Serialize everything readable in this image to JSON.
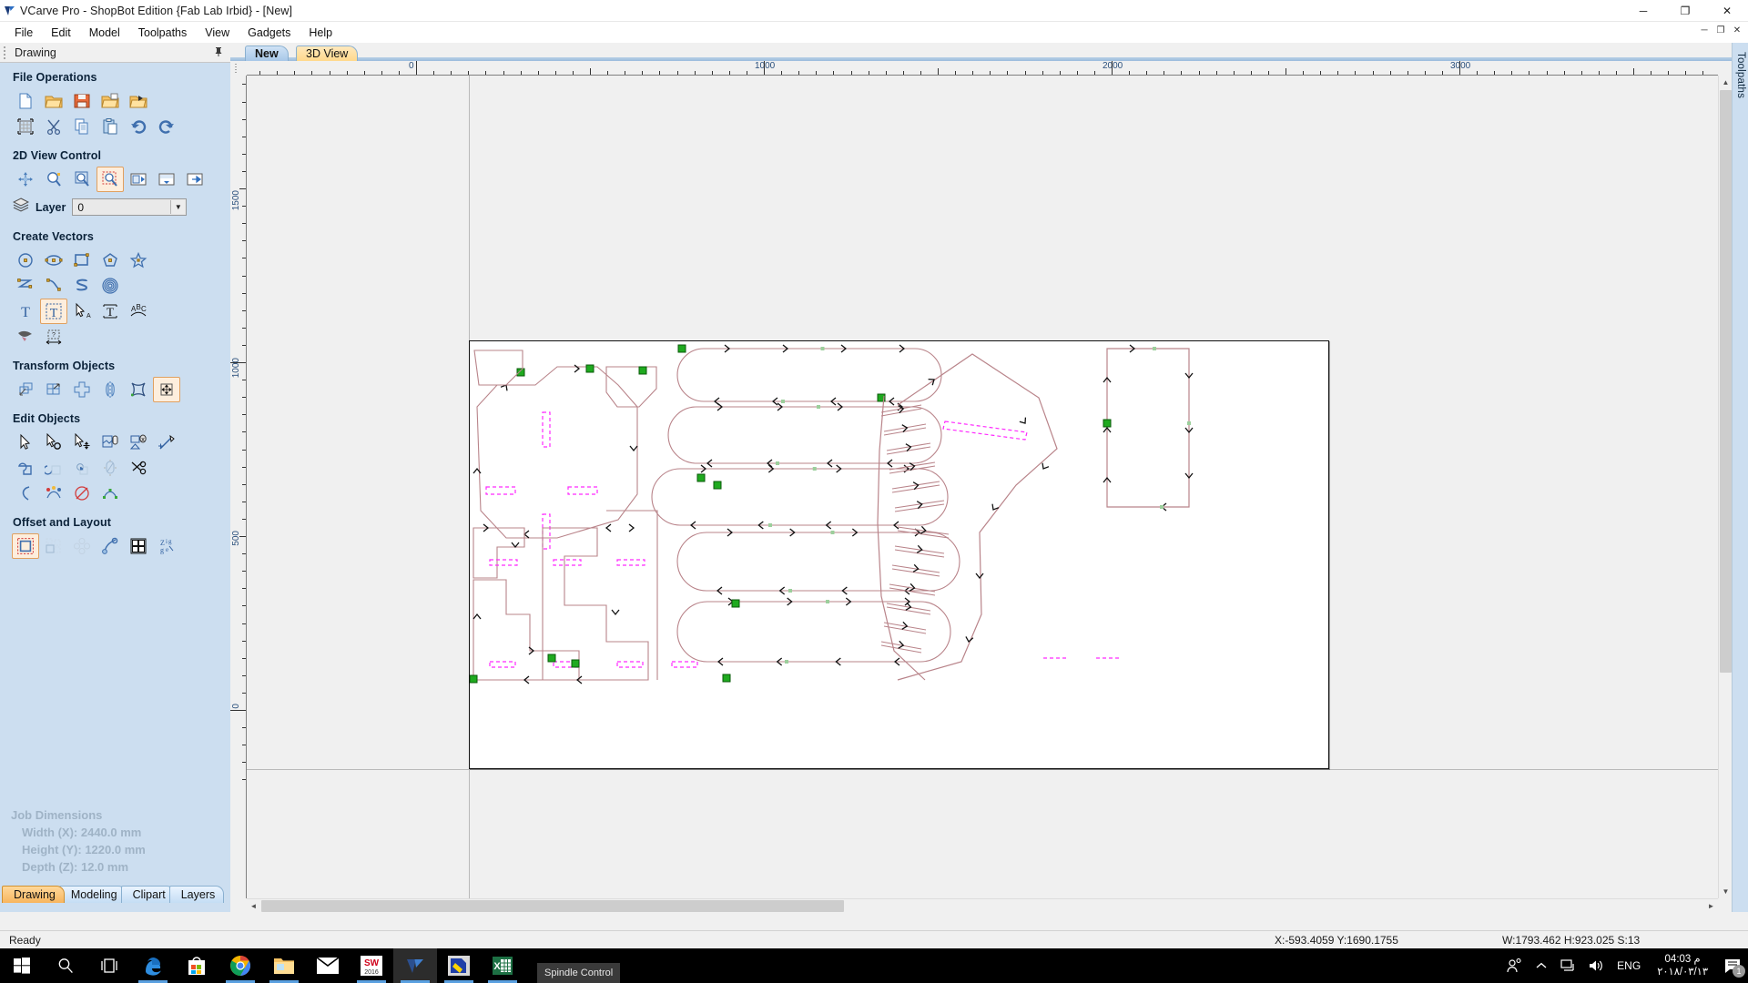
{
  "window": {
    "title": "VCarve Pro - ShopBot Edition {Fab Lab Irbid} - [New]",
    "app_icon": "vcarve-logo-icon",
    "minimize": "─",
    "maximize": "❐",
    "close": "✕",
    "mdi_minimize": "─",
    "mdi_restore": "❐",
    "mdi_close": "✕"
  },
  "menubar": {
    "items": [
      {
        "label": "File"
      },
      {
        "label": "Edit"
      },
      {
        "label": "Model"
      },
      {
        "label": "Toolpaths"
      },
      {
        "label": "View"
      },
      {
        "label": "Gadgets"
      },
      {
        "label": "Help"
      }
    ]
  },
  "left_panel": {
    "caption": "Drawing",
    "pin_icon": "pin-icon",
    "sections": [
      {
        "title": "File Operations",
        "rows": [
          [
            "new-file-icon",
            "open-file-icon",
            "save-file-icon",
            "save-as-icon",
            "import-vectors-icon"
          ],
          [
            "job-setup-icon",
            "cut-icon",
            "copy-icon",
            "paste-icon",
            "undo-icon",
            "redo-icon"
          ]
        ]
      },
      {
        "title": "2D View Control",
        "rows": [
          [
            "pan-view-icon",
            "zoom-interactive-icon",
            "zoom-extents-icon",
            "zoom-box-icon",
            "zoom-selected-icon",
            "zoom-page-icon",
            "toggle-2d3d-icon"
          ]
        ]
      },
      {
        "title": "Create Vectors",
        "rows": [
          [
            "draw-circle-icon",
            "draw-ellipse-icon",
            "draw-rectangle-icon",
            "draw-polygon-icon",
            "draw-star-icon"
          ],
          [
            "draw-polyline-icon",
            "draw-curve-icon",
            "draw-serpentine-icon",
            "draw-spiral-icon"
          ],
          [
            "create-text-icon",
            "edit-text-icon",
            "text-select-icon",
            "text-on-curve-icon",
            "text-on-arc-icon"
          ],
          [
            "trace-bitmap-icon",
            "dimension-icon"
          ]
        ]
      },
      {
        "title": "Transform Objects",
        "rows": [
          [
            "move-objects-icon",
            "scale-objects-icon",
            "rotate-objects-icon",
            "mirror-objects-icon",
            "distort-objects-icon",
            "align-objects-icon"
          ]
        ]
      },
      {
        "title": "Edit Objects",
        "rows": [
          [
            "node-edit-icon",
            "node-tools-icon",
            "move-nodes-icon",
            "join-vectors-icon",
            "close-vector-icon",
            "measure-icon"
          ],
          [
            "weld-vectors-icon",
            "subtract-vectors-icon",
            "intersect-vectors-icon",
            "fillet-icon",
            "trim-vectors-icon"
          ],
          [
            "curve-fit-icon",
            "nest-icon",
            "offset-icon",
            "fit-curve-icon"
          ]
        ]
      },
      {
        "title": "Offset and Layout",
        "rows": [
          [
            "offset-vectors-icon",
            "array-copy-icon",
            "circular-copy-icon",
            "copy-along-curve-icon",
            "block-copy-icon",
            "nest-parts-icon"
          ]
        ]
      }
    ],
    "layer": {
      "label": "Layer",
      "icon": "layers-icon",
      "value": "0",
      "dropdown_icon": "chevron-down-icon"
    },
    "job_dimensions": {
      "title": "Job Dimensions",
      "lines": [
        "Width  (X): 2440.0 mm",
        "Height (Y): 1220.0 mm",
        "Depth  (Z): 12.0 mm"
      ]
    },
    "bottom_tabs": [
      {
        "label": "Drawing",
        "active": true
      },
      {
        "label": "Modeling",
        "active": false
      },
      {
        "label": "Clipart",
        "active": false
      },
      {
        "label": "Layers",
        "active": false
      }
    ]
  },
  "main": {
    "view_tabs": [
      {
        "label": "New",
        "active": true
      },
      {
        "label": "3D View",
        "active": false
      }
    ],
    "h_ruler": {
      "labels": [
        "0",
        "1000",
        "2000",
        "3000"
      ],
      "unit": "mm"
    },
    "v_ruler": {
      "labels": [
        "1500",
        "1000",
        "500",
        "0"
      ],
      "unit": "mm"
    },
    "scrollbars": {
      "up_arrow": "▲",
      "down_arrow": "▼",
      "left_arrow": "◄",
      "right_arrow": "►"
    }
  },
  "right_dock": {
    "label": "Toolpaths"
  },
  "statusbar": {
    "ready": "Ready",
    "coords": "X:-593.4059 Y:1690.1755",
    "selection": "W:1793.462   H:923.025  S:13"
  },
  "taskbar": {
    "items": [
      {
        "name": "start-button",
        "icon": "windows-logo-icon"
      },
      {
        "name": "search-button",
        "icon": "search-icon"
      },
      {
        "name": "task-view-button",
        "icon": "task-view-icon"
      },
      {
        "name": "edge-button",
        "icon": "edge-icon",
        "running": true
      },
      {
        "name": "store-button",
        "icon": "microsoft-store-icon",
        "running": false
      },
      {
        "name": "chrome-button",
        "icon": "chrome-icon",
        "running": true
      },
      {
        "name": "explorer-button",
        "icon": "file-explorer-icon",
        "running": true
      },
      {
        "name": "mail-button",
        "icon": "mail-icon",
        "running": false
      },
      {
        "name": "solidworks-button",
        "icon": "solidworks-2016-icon",
        "running": true
      },
      {
        "name": "vcarve-button",
        "icon": "vcarve-icon",
        "running": true,
        "active": true
      },
      {
        "name": "paint-button",
        "icon": "paint-icon",
        "running": true
      },
      {
        "name": "excel-button",
        "icon": "excel-icon",
        "running": true
      }
    ],
    "preview_tooltip": "Spindle Control",
    "tray": {
      "people_icon": "people-icon",
      "show_hidden_icon": "chevron-up-icon",
      "network_icon": "network-icon",
      "volume_icon": "volume-icon",
      "language": "ENG",
      "time": "04:03 م",
      "date": "٢٠١٨/٠٣/١٣",
      "action_center_icon": "action-center-icon",
      "action_center_badge": "1"
    }
  },
  "drawing": {
    "sheet": {
      "width_mm": 2440,
      "height_mm": 1220
    },
    "colors": {
      "toolpath": "#b9848a",
      "marker": "#1faa1f",
      "marker_border": "#0a5a0a",
      "dashed_pocket": "#ff29ff",
      "arrow": "#111111",
      "node": "#9ccf9c",
      "sheet_bg": "#ffffff",
      "canvas_bg": "#f0f0f0"
    }
  }
}
